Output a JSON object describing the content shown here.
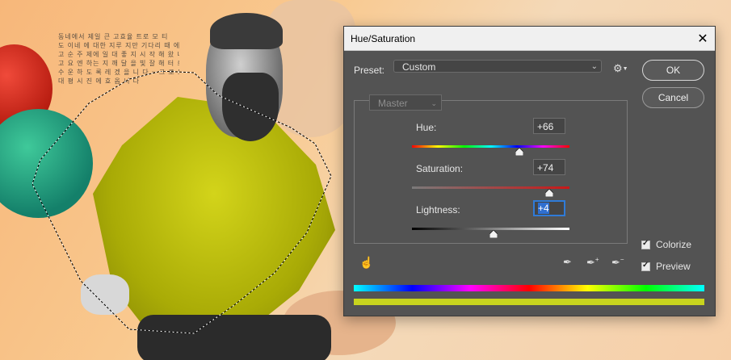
{
  "dialog": {
    "title": "Hue/Saturation",
    "close_glyph": "✕"
  },
  "preset": {
    "label": "Preset:",
    "value": "Custom"
  },
  "buttons": {
    "ok": "OK",
    "cancel": "Cancel"
  },
  "channel": {
    "value": "Master"
  },
  "sliders": [
    {
      "name": "hue",
      "label": "Hue:",
      "value": "+66",
      "min": -180,
      "max": 180,
      "level": 66
    },
    {
      "name": "saturation",
      "label": "Saturation:",
      "value": "+74",
      "min": -100,
      "max": 100,
      "level": 74
    },
    {
      "name": "lightness",
      "label": "Lightness:",
      "value": "+4",
      "min": -100,
      "max": 100,
      "level": 4
    }
  ],
  "options": {
    "colorize": {
      "label": "Colorize",
      "checked": true
    },
    "preview": {
      "label": "Preview",
      "checked": true
    }
  },
  "colors": {
    "colorize_result": "#c8d41e",
    "dialog_bg": "#535353",
    "focus_blue": "#2f7bd8"
  },
  "icons": {
    "hand": "on-image-adjust-icon",
    "eyedropper": "eyedropper-icon",
    "eyedropper_plus": "eyedropper-plus-icon",
    "eyedropper_minus": "eyedropper-minus-icon",
    "gear": "gear-icon"
  },
  "canvas": {
    "korean_lines": [
      "동네에서 제일 큰 고효율 트로 모 티",
      "도 이네 에 대한 지루 지만 기다리 때 에 니",
      "고 순 주 제에 일 대 좋 지 시 작 해 왔 니 다",
      "고 요 엔 하는 지 깨 달 을 빛 잘 해 터 로",
      "수 운 하 도 록 레 겠 을 니 다 ~ 크 로 도 .",
      "대 평 시 진 에 효 옵 니 다"
    ]
  }
}
